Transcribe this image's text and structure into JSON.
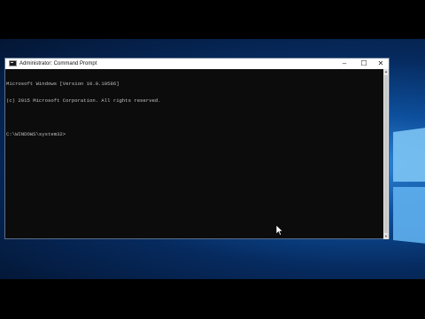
{
  "window": {
    "title": "Administrator: Command Prompt",
    "icon": "console-app-icon",
    "controls": {
      "minimize": "–",
      "maximize": "☐",
      "close": "✕"
    }
  },
  "console": {
    "line_1": "Microsoft Windows [Version 10.0.10586]",
    "line_2": "(c) 2015 Microsoft Corporation. All rights reserved.",
    "line_3": "",
    "prompt": "C:\\WINDOWS\\system32>"
  },
  "scrollbar": {
    "up_glyph": "▲",
    "down_glyph": "▼"
  },
  "desktop": {
    "wallpaper": "windows-logo-wallpaper",
    "colors": {
      "wallpaper_dark": "#041634",
      "wallpaper_glow": "#2f86d8",
      "console_bg": "#0c0c0c",
      "console_text": "#c0c0c0",
      "titlebar_bg": "#ffffff"
    }
  }
}
